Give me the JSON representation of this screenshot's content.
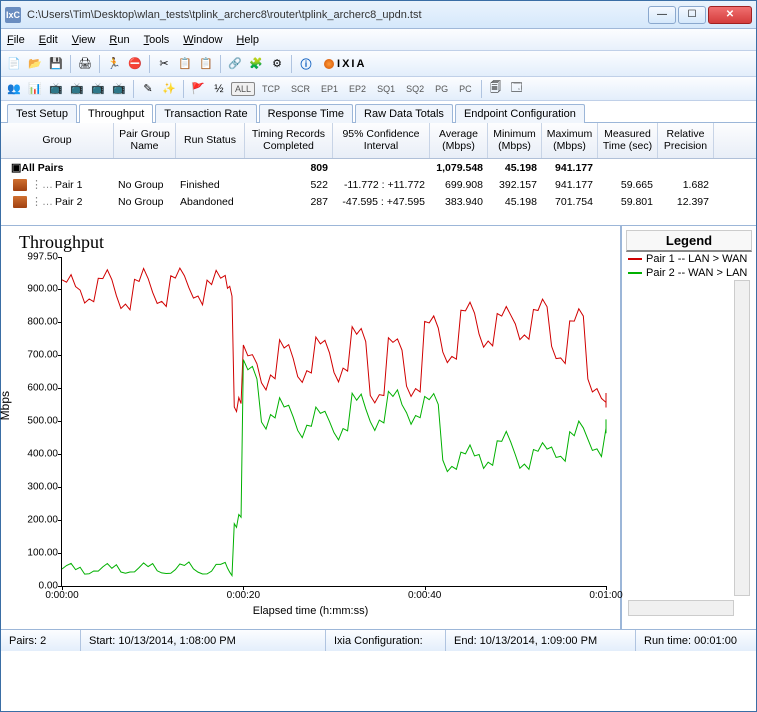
{
  "titlebar": {
    "icon_text": "IxC",
    "path": "C:\\Users\\Tim\\Desktop\\wlan_tests\\tplink_archerc8\\router\\tplink_archerc8_updn.tst"
  },
  "menus": {
    "file": "File",
    "edit": "Edit",
    "view": "View",
    "run": "Run",
    "tools": "Tools",
    "window": "Window",
    "help": "Help"
  },
  "toolbar2": {
    "all": "ALL",
    "tcp": "TCP",
    "scr": "SCR",
    "ep1": "EP1",
    "ep2": "EP2",
    "sq1": "SQ1",
    "sq2": "SQ2",
    "pg": "PG",
    "pc": "PC"
  },
  "tabs": {
    "setup": "Test Setup",
    "throughput": "Throughput",
    "trans": "Transaction Rate",
    "resp": "Response Time",
    "raw": "Raw Data Totals",
    "ep": "Endpoint Configuration"
  },
  "grid": {
    "headers": {
      "group": "Group",
      "pair": "Pair Group Name",
      "run": "Run Status",
      "timing": "Timing Records Completed",
      "conf": "95% Confidence Interval",
      "avg": "Average (Mbps)",
      "min": "Minimum (Mbps)",
      "max": "Maximum (Mbps)",
      "meas": "Measured Time (sec)",
      "rel": "Relative Precision"
    },
    "rows": [
      {
        "label": "All Pairs",
        "pair": "",
        "run": "",
        "timing": "809",
        "conf": "",
        "avg": "1,079.548",
        "min": "45.198",
        "max": "941.177",
        "meas": "",
        "rel": "",
        "bold": true
      },
      {
        "label": "Pair 1",
        "pair": "No Group",
        "run": "Finished",
        "timing": "522",
        "conf": "-11.772 : +11.772",
        "avg": "699.908",
        "min": "392.157",
        "max": "941.177",
        "meas": "59.665",
        "rel": "1.682"
      },
      {
        "label": "Pair 2",
        "pair": "No Group",
        "run": "Abandoned",
        "timing": "287",
        "conf": "-47.595 : +47.595",
        "avg": "383.940",
        "min": "45.198",
        "max": "701.754",
        "meas": "59.801",
        "rel": "12.397"
      }
    ]
  },
  "chart_title": "Throughput",
  "legend": {
    "title": "Legend",
    "s1": "Pair 1 -- LAN > WAN",
    "s2": "Pair 2 -- WAN > LAN"
  },
  "axis": {
    "ylabel": "Mbps",
    "xlabel": "Elapsed time (h:mm:ss)"
  },
  "status": {
    "pairs": "Pairs: 2",
    "start": "Start: 10/13/2014, 1:08:00 PM",
    "ixia": "Ixia Configuration:",
    "end": "End: 10/13/2014, 1:09:00 PM",
    "runtime": "Run time: 00:01:00"
  },
  "chart_data": {
    "type": "line",
    "title": "Throughput",
    "xlabel": "Elapsed time (h:mm:ss)",
    "ylabel": "Mbps",
    "ylim": [
      0,
      997.5
    ],
    "xlim_seconds": [
      0,
      60
    ],
    "x_ticks": [
      "0:00:00",
      "0:00:20",
      "0:00:40",
      "0:01:00"
    ],
    "y_ticks": [
      0,
      100,
      200,
      300,
      400,
      500,
      600,
      700,
      800,
      900,
      997.5
    ],
    "series": [
      {
        "name": "Pair 1 -- LAN > WAN",
        "color": "#d00000",
        "x": [
          0,
          2,
          4,
          6,
          8,
          10,
          12,
          14,
          16,
          18,
          19,
          20,
          22,
          24,
          26,
          28,
          30,
          32,
          34,
          36,
          38,
          40,
          42,
          44,
          46,
          48,
          50,
          52,
          54,
          56,
          58,
          60
        ],
        "y": [
          920,
          880,
          930,
          860,
          930,
          870,
          940,
          880,
          930,
          910,
          550,
          700,
          620,
          720,
          640,
          730,
          650,
          760,
          580,
          730,
          600,
          790,
          700,
          830,
          750,
          820,
          770,
          840,
          700,
          810,
          600,
          560
        ]
      },
      {
        "name": "Pair 2 -- WAN > LAN",
        "color": "#00b000",
        "x": [
          0,
          2,
          4,
          6,
          8,
          10,
          12,
          14,
          16,
          18,
          19,
          20,
          22,
          24,
          26,
          28,
          30,
          32,
          34,
          36,
          38,
          40,
          42,
          44,
          46,
          48,
          50,
          52,
          54,
          56,
          58,
          60
        ],
        "y": [
          50,
          52,
          48,
          55,
          50,
          54,
          49,
          55,
          50,
          52,
          200,
          660,
          500,
          540,
          480,
          520,
          470,
          560,
          500,
          570,
          520,
          560,
          370,
          400,
          380,
          440,
          380,
          410,
          400,
          470,
          420,
          480
        ]
      }
    ]
  }
}
